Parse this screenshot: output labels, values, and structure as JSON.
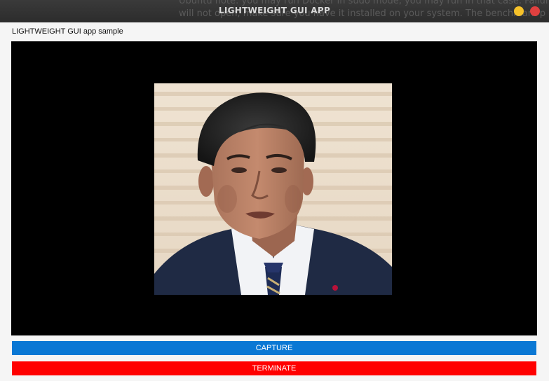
{
  "window": {
    "title": "LIGHTWEIGHT GUI APP",
    "background_text": [
      "Ubuntu note: you may run Docker in sudo mode, you may run in that case. Failure is a result. If Docker",
      "will not open, make sure you have it installed on your system. The benchmark p"
    ]
  },
  "app": {
    "label": "LIGHTWEIGHT GUI app sample"
  },
  "video": {
    "background": "#000000",
    "frame_content": "portrait-photo"
  },
  "buttons": {
    "capture_label": "CAPTURE",
    "capture_color": "#0a78d4",
    "terminate_label": "TERMINATE",
    "terminate_color": "#ff0000"
  },
  "controls": {
    "minimize_color": "#f5c12a",
    "close_color": "#e0403f"
  }
}
